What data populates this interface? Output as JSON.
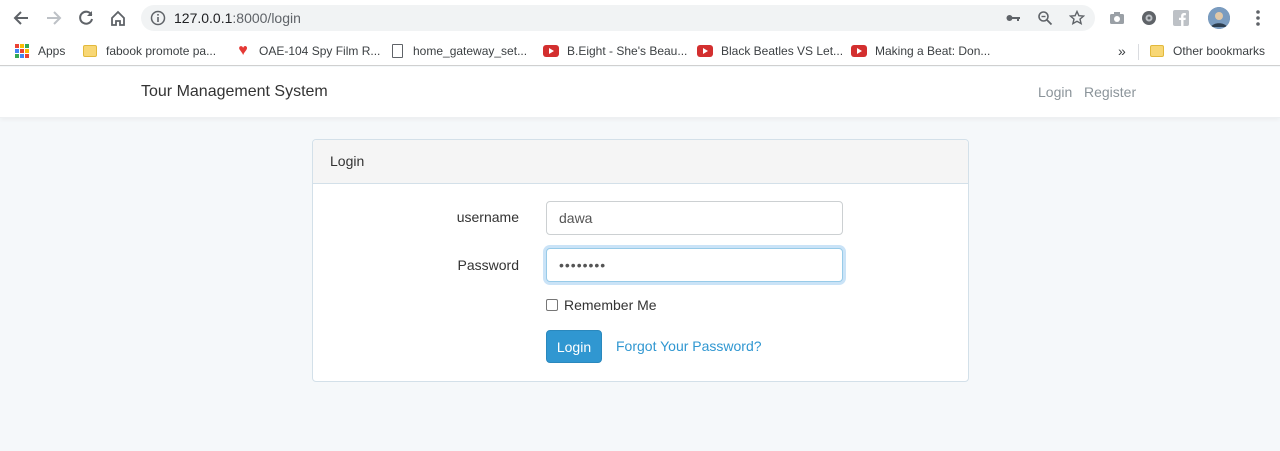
{
  "browser": {
    "url_host": "127.0.0.1",
    "url_path": ":8000/login",
    "icons": [
      "back-icon",
      "forward-icon",
      "reload-icon",
      "home-icon",
      "info-icon",
      "key-icon",
      "zoom-icon",
      "star-icon",
      "camera-icon",
      "extension-icon",
      "facebook-icon",
      "profile-avatar",
      "menu-icon"
    ]
  },
  "bookmarks": {
    "apps_label": "Apps",
    "items": [
      {
        "label": "fabook promote pa...",
        "icon": "folder-icon"
      },
      {
        "label": "OAE-104 Spy Film R...",
        "icon": "heart-icon"
      },
      {
        "label": "home_gateway_set...",
        "icon": "document-icon"
      },
      {
        "label": "B.Eight - She's Beau...",
        "icon": "youtube-icon"
      },
      {
        "label": "Black Beatles VS Let...",
        "icon": "youtube-icon"
      },
      {
        "label": "Making a Beat: Don...",
        "icon": "youtube-icon"
      }
    ],
    "overflow_label": "»",
    "other_label": "Other bookmarks"
  },
  "navbar": {
    "brand": "Tour Management System",
    "login": "Login",
    "register": "Register"
  },
  "login_card": {
    "header": "Login",
    "username_label": "username",
    "username_value": "dawa",
    "password_label": "Password",
    "password_value": "••••••••",
    "remember_label": "Remember Me",
    "remember_checked": false,
    "submit_label": "Login",
    "forgot_label": "Forgot Your Password?"
  },
  "colors": {
    "primary": "#3097d1",
    "page_bg": "#f5f8fa",
    "card_border": "#d3e0e9"
  }
}
